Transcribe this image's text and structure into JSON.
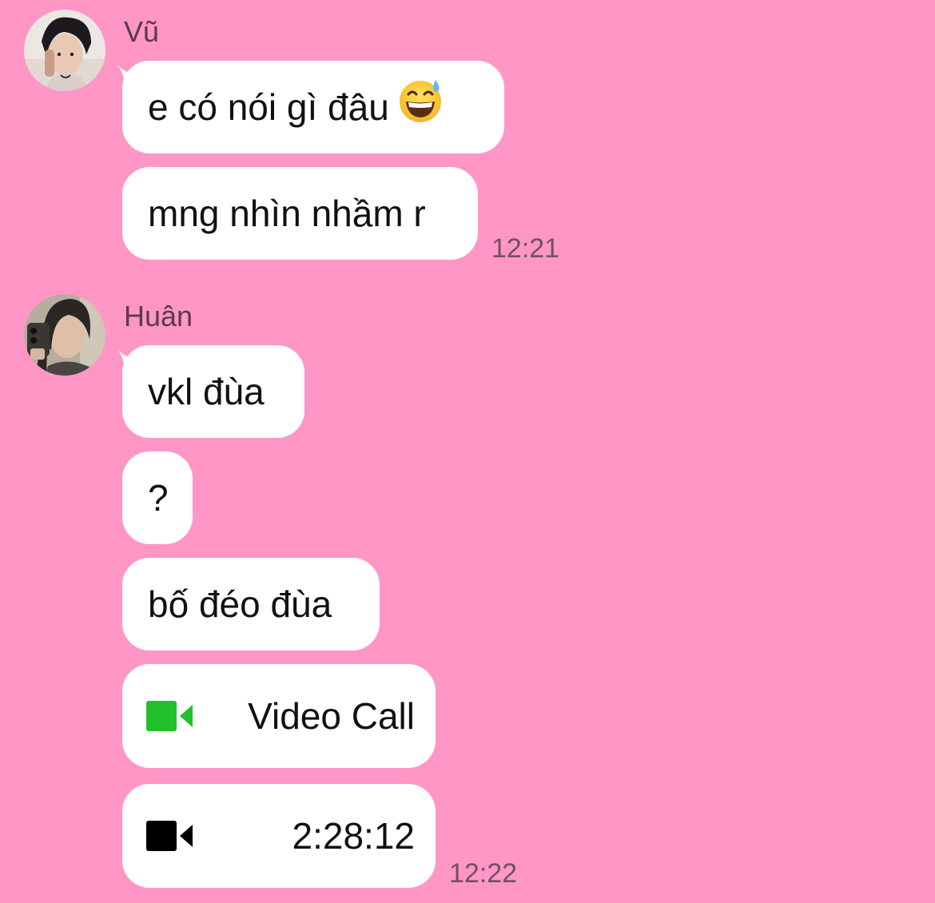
{
  "messages": [
    {
      "sender": "Vũ",
      "bubbles": [
        "e có nói gì đâu",
        "mng nhìn nhầm r"
      ],
      "emoji": "grinning-face-with-sweat-icon",
      "time": "12:21"
    },
    {
      "sender": "Huân",
      "bubbles": [
        "vkl đùa",
        "?",
        "bố đéo đùa"
      ],
      "video_call": {
        "label": "Video Call",
        "icon": "video-camera-icon",
        "icon_color": "#22C02C"
      },
      "call_duration": {
        "value": "2:28:12",
        "icon": "video-camera-icon",
        "icon_color": "#000000"
      },
      "time": "12:22"
    }
  ],
  "colors": {
    "background": "#FF96C5",
    "bubble": "#FFFFFF"
  }
}
